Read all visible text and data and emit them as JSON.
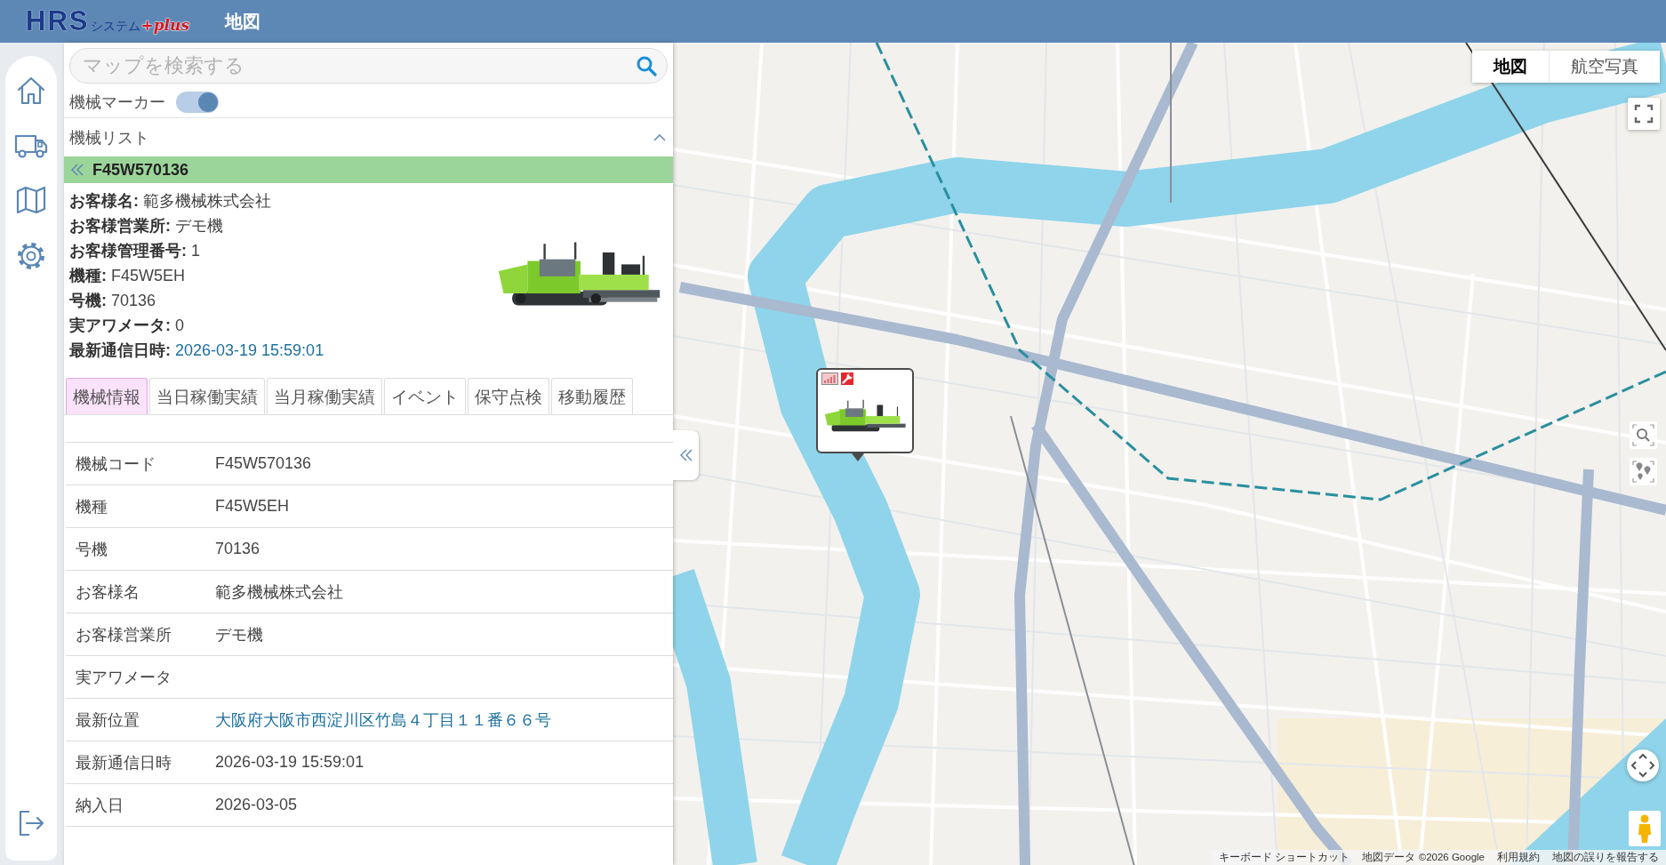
{
  "header": {
    "logo": {
      "main": "HRS",
      "sub": "システム",
      "plus": "+plus"
    },
    "title": "地図"
  },
  "search": {
    "placeholder": "マップを検索する"
  },
  "marker_toggle": {
    "label": "機械マーカー",
    "on": true
  },
  "machine_list": {
    "title": "機械リスト",
    "expanded": true
  },
  "selected_machine": {
    "code": "F45W570136",
    "details": [
      {
        "label": "お客様名:",
        "value": "範多機械株式会社",
        "kind": "text"
      },
      {
        "label": "お客様営業所:",
        "value": "デモ機",
        "kind": "text"
      },
      {
        "label": "お客様管理番号:",
        "value": "1",
        "kind": "text"
      },
      {
        "label": "機種:",
        "value": "F45W5EH",
        "kind": "text"
      },
      {
        "label": "号機:",
        "value": "70136",
        "kind": "text"
      },
      {
        "label": "実アワメータ:",
        "value": "0",
        "kind": "text"
      },
      {
        "label": "最新通信日時:",
        "value": "2026-03-19 15:59:01",
        "kind": "link"
      }
    ]
  },
  "tabs": [
    {
      "label": "機械情報",
      "selected": true
    },
    {
      "label": "当日稼働実績",
      "selected": false
    },
    {
      "label": "当月稼働実績",
      "selected": false
    },
    {
      "label": "イベント",
      "selected": false
    },
    {
      "label": "保守点検",
      "selected": false
    },
    {
      "label": "移動履歴",
      "selected": false
    }
  ],
  "info_table": {
    "rows": [
      {
        "label": "機械コード",
        "value": "F45W570136",
        "kind": "text"
      },
      {
        "label": "機種",
        "value": "F45W5EH",
        "kind": "text"
      },
      {
        "label": "号機",
        "value": "70136",
        "kind": "text"
      },
      {
        "label": "お客様名",
        "value": "範多機械株式会社",
        "kind": "text"
      },
      {
        "label": "お客様営業所",
        "value": "デモ機",
        "kind": "text"
      },
      {
        "label": "実アワメータ"
      },
      {
        "label": "最新位置",
        "value": "大阪府大阪市西淀川区竹島４丁目１１番６６号",
        "kind": "link"
      },
      {
        "label": "最新通信日時",
        "value": "2026-03-19 15:59:01",
        "kind": "text"
      },
      {
        "label": "納入日",
        "value": "2026-03-05",
        "kind": "text"
      }
    ]
  },
  "map": {
    "type_buttons": [
      {
        "label": "地図",
        "selected": true
      },
      {
        "label": "航空写真",
        "selected": false
      }
    ],
    "attribution": [
      "キーボード ショートカット",
      "地図データ ©2026 Google",
      "利用規約",
      "地図の誤りを報告する"
    ]
  }
}
